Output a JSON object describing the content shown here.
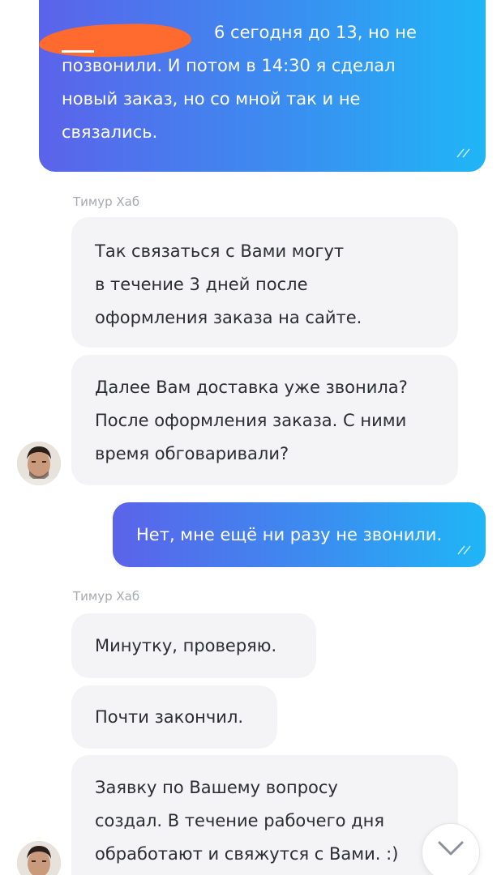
{
  "messages": {
    "out1": {
      "lines": [
        "6 сегодня до 13, но не",
        "позвонили. И потом в 14:30 я сделал",
        "новый заказ, но со мной так и не",
        "связались."
      ]
    },
    "in_group1": {
      "sender": "Тимур Хаб",
      "bubble1": [
        "Так связаться с Вами могут",
        "в течение 3 дней после",
        "оформления заказа на сайте."
      ],
      "bubble2": [
        "Далее Вам доставка уже звонила?",
        "После оформления заказа. С ними",
        "время обговаривали?"
      ]
    },
    "out2": {
      "text": "Нет, мне ещё ни разу не звонили."
    },
    "in_group2": {
      "sender": "Тимур Хаб",
      "bubble1": "Минутку, проверяю.",
      "bubble2": "Почти закончил.",
      "bubble3": [
        "Заявку по Вашему вопросу",
        "создал. В течение рабочего дня",
        "обработают и свяжутся с Вами. :)"
      ]
    }
  },
  "icons": {
    "read_ticks": "double-check-icon",
    "scroll": "chevron-down-icon"
  },
  "colors": {
    "outgoing_start": "#5b63ea",
    "outgoing_end": "#1fb6f6",
    "incoming_bg": "#f4f4f6",
    "redaction": "#ff6a2e"
  }
}
